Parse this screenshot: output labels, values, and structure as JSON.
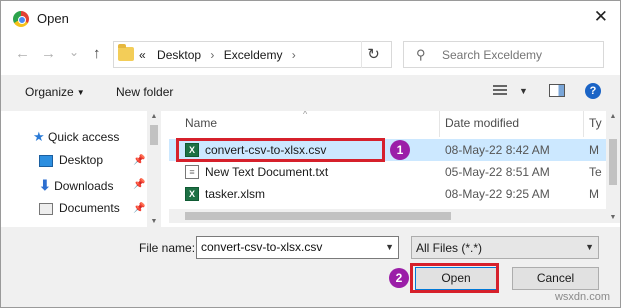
{
  "window": {
    "title": "Open",
    "close_glyph": "✕"
  },
  "navigation": {
    "back_glyph": "←",
    "forward_glyph": "→",
    "recent_glyph": "⌄",
    "up_glyph": "↑",
    "breadcrumb_prefix": "«",
    "breadcrumb": [
      "Desktop",
      "Exceldemy"
    ],
    "breadcrumb_separator": "›",
    "refresh_glyph": "↻",
    "search_placeholder": "Search Exceldemy"
  },
  "toolbar": {
    "organize_label": "Organize",
    "new_folder_label": "New folder",
    "help_label": "?"
  },
  "nav_pane": {
    "items": [
      {
        "label": "Quick access",
        "icon": "star-icon"
      },
      {
        "label": "Desktop",
        "icon": "desktop-icon",
        "pinned": true
      },
      {
        "label": "Downloads",
        "icon": "downloads-icon",
        "pinned": true
      },
      {
        "label": "Documents",
        "icon": "documents-icon",
        "pinned": true
      }
    ]
  },
  "file_list": {
    "columns": [
      "Name",
      "Date modified",
      "Ty"
    ],
    "rows": [
      {
        "name": "convert-csv-to-xlsx.csv",
        "date": "08-May-22 8:42 AM",
        "type": "M",
        "icon": "excel-csv-icon",
        "selected": true
      },
      {
        "name": "New Text Document.txt",
        "date": "05-May-22 8:51 AM",
        "type": "Te",
        "icon": "text-file-icon",
        "selected": false
      },
      {
        "name": "tasker.xlsm",
        "date": "08-May-22 9:25 AM",
        "type": "M",
        "icon": "excel-macro-icon",
        "selected": false
      }
    ]
  },
  "bottom": {
    "file_name_label": "File name:",
    "file_name_value": "convert-csv-to-xlsx.csv",
    "file_type_value": "All Files (*.*)",
    "open_label": "Open",
    "cancel_label": "Cancel"
  },
  "annotations": {
    "marker_1": "1",
    "marker_2": "2",
    "color": "#d6202b",
    "marker_color": "#9b1ea8"
  },
  "watermark": "wsxdn.com"
}
